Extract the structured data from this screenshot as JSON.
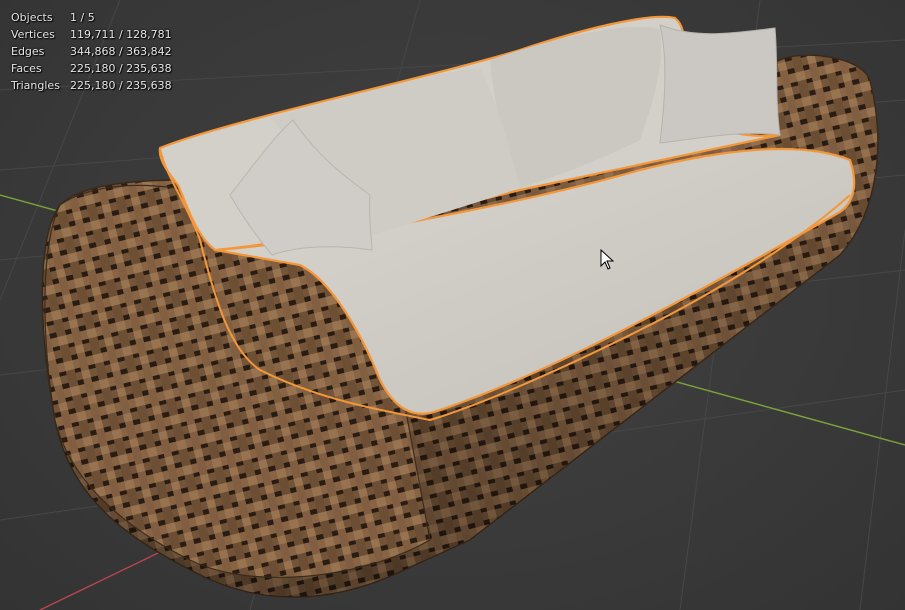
{
  "viewport": {
    "stats": [
      {
        "label": "Objects",
        "value": "1 / 5"
      },
      {
        "label": "Vertices",
        "value": "119,711 / 128,781"
      },
      {
        "label": "Edges",
        "value": "344,868 / 363,842"
      },
      {
        "label": "Faces",
        "value": "225,180 / 235,638"
      },
      {
        "label": "Triangles",
        "value": "225,180 / 235,638"
      }
    ],
    "colors": {
      "background": "#393939",
      "grid_line": "#474747",
      "x_axis": "#b8464f",
      "y_axis": "#7da33a",
      "selection_outline": "#f3973a",
      "wicker": "#7a5a3d",
      "cushion": "#cfcbc5"
    },
    "scene_object": "wicker-sofa",
    "cursor_icon": "arrow-cursor-icon"
  }
}
